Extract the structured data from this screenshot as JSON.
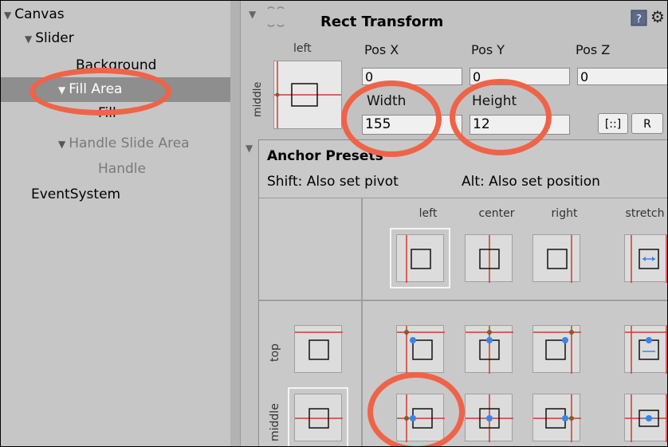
{
  "hierarchy": {
    "items": [
      {
        "label": "Canvas",
        "arrow": "▼"
      },
      {
        "label": "Slider",
        "arrow": "▼"
      },
      {
        "label": "Background",
        "arrow": ""
      },
      {
        "label": "Fill Area",
        "arrow": "▼"
      },
      {
        "label": "Fill",
        "arrow": ""
      },
      {
        "label": "Handle Slide Area",
        "arrow": "▼"
      },
      {
        "label": "Handle",
        "arrow": ""
      },
      {
        "label": "EventSystem",
        "arrow": ""
      }
    ]
  },
  "inspector": {
    "component_title": "Rect Transform",
    "anchor_horizontal_label": "left",
    "anchor_vertical_label": "middle",
    "pos_x_label": "Pos X",
    "pos_y_label": "Pos Y",
    "pos_z_label": "Pos Z",
    "pos_x_value": "0",
    "pos_y_value": "0",
    "pos_z_value": "0",
    "width_label": "Width",
    "height_label": "Height",
    "width_value": "155",
    "height_value": "12",
    "blueprint_button": "[::]",
    "raw_button": "R"
  },
  "anchor_presets": {
    "title": "Anchor Presets",
    "shift_hint": "Shift: Also set pivot",
    "alt_hint": "Alt: Also set position",
    "columns": [
      "left",
      "center",
      "right",
      "stretch"
    ],
    "rows": [
      "top",
      "middle"
    ]
  },
  "colors": {
    "highlight_circle": "#ef6348",
    "anchor_line": "#d23a2a",
    "pivot_dot": "#3d83e6",
    "selected_row": "#8e8e8e"
  }
}
